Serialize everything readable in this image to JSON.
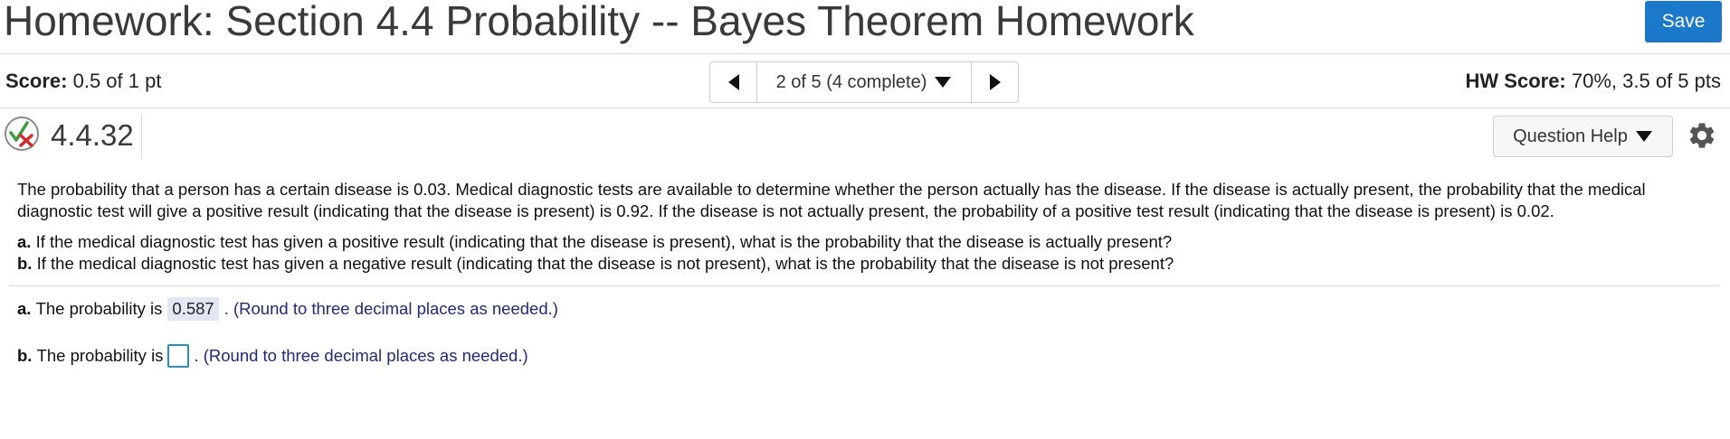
{
  "header": {
    "title": "Homework: Section 4.4 Probability -- Bayes Theorem Homework",
    "save_label": "Save"
  },
  "scorebar": {
    "score_label": "Score:",
    "score_value": "0.5 of 1 pt",
    "nav_label": "2 of 5 (4 complete)",
    "hw_score_label": "HW Score:",
    "hw_score_value": "70%, 3.5 of 5 pts"
  },
  "question": {
    "number": "4.4.32",
    "help_label": "Question Help",
    "status_icon": "partial-correct-icon",
    "intro": "The probability that a person has a certain disease is 0.03. Medical diagnostic tests are available to determine whether the person actually has the disease. If the disease is actually present, the probability that the medical diagnostic test will give a positive result (indicating that the disease is present) is 0.92. If the disease is not actually present, the probability of a positive test result (indicating that the disease is present) is 0.02.",
    "parts": [
      {
        "letter": "a.",
        "text": "If the medical diagnostic test has given a positive result (indicating that the disease is present), what is the probability that the disease is actually present?"
      },
      {
        "letter": "b.",
        "text": "If the medical diagnostic test has given a negative result (indicating that the disease is not present), what is the probability that the disease is not present?"
      }
    ]
  },
  "answers": {
    "a": {
      "letter": "a.",
      "prefix": "The probability is",
      "value": "0.587",
      "hint": ". (Round to three decimal places as needed.)"
    },
    "b": {
      "letter": "b.",
      "prefix": "The probability is",
      "value": "",
      "hint": ". (Round to three decimal places as needed.)"
    }
  },
  "colors": {
    "accent": "#1c78c9",
    "hint_text": "#1f2a73",
    "answer_highlight": "#e1e8f3",
    "input_border": "#2a8fbf"
  }
}
